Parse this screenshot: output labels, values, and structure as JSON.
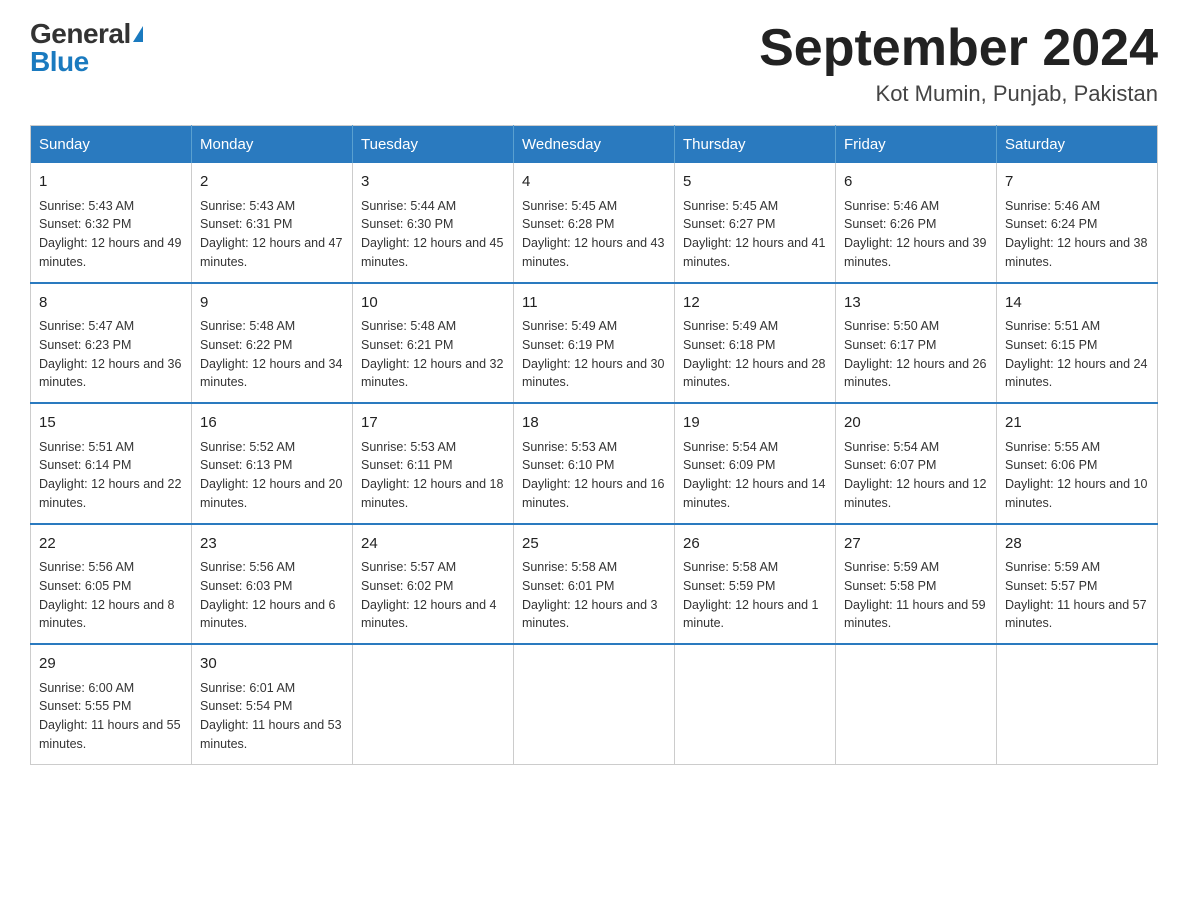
{
  "logo": {
    "general": "General",
    "blue": "Blue"
  },
  "title": "September 2024",
  "subtitle": "Kot Mumin, Punjab, Pakistan",
  "weekdays": [
    "Sunday",
    "Monday",
    "Tuesday",
    "Wednesday",
    "Thursday",
    "Friday",
    "Saturday"
  ],
  "weeks": [
    [
      {
        "day": "1",
        "sunrise": "5:43 AM",
        "sunset": "6:32 PM",
        "daylight": "12 hours and 49 minutes."
      },
      {
        "day": "2",
        "sunrise": "5:43 AM",
        "sunset": "6:31 PM",
        "daylight": "12 hours and 47 minutes."
      },
      {
        "day": "3",
        "sunrise": "5:44 AM",
        "sunset": "6:30 PM",
        "daylight": "12 hours and 45 minutes."
      },
      {
        "day": "4",
        "sunrise": "5:45 AM",
        "sunset": "6:28 PM",
        "daylight": "12 hours and 43 minutes."
      },
      {
        "day": "5",
        "sunrise": "5:45 AM",
        "sunset": "6:27 PM",
        "daylight": "12 hours and 41 minutes."
      },
      {
        "day": "6",
        "sunrise": "5:46 AM",
        "sunset": "6:26 PM",
        "daylight": "12 hours and 39 minutes."
      },
      {
        "day": "7",
        "sunrise": "5:46 AM",
        "sunset": "6:24 PM",
        "daylight": "12 hours and 38 minutes."
      }
    ],
    [
      {
        "day": "8",
        "sunrise": "5:47 AM",
        "sunset": "6:23 PM",
        "daylight": "12 hours and 36 minutes."
      },
      {
        "day": "9",
        "sunrise": "5:48 AM",
        "sunset": "6:22 PM",
        "daylight": "12 hours and 34 minutes."
      },
      {
        "day": "10",
        "sunrise": "5:48 AM",
        "sunset": "6:21 PM",
        "daylight": "12 hours and 32 minutes."
      },
      {
        "day": "11",
        "sunrise": "5:49 AM",
        "sunset": "6:19 PM",
        "daylight": "12 hours and 30 minutes."
      },
      {
        "day": "12",
        "sunrise": "5:49 AM",
        "sunset": "6:18 PM",
        "daylight": "12 hours and 28 minutes."
      },
      {
        "day": "13",
        "sunrise": "5:50 AM",
        "sunset": "6:17 PM",
        "daylight": "12 hours and 26 minutes."
      },
      {
        "day": "14",
        "sunrise": "5:51 AM",
        "sunset": "6:15 PM",
        "daylight": "12 hours and 24 minutes."
      }
    ],
    [
      {
        "day": "15",
        "sunrise": "5:51 AM",
        "sunset": "6:14 PM",
        "daylight": "12 hours and 22 minutes."
      },
      {
        "day": "16",
        "sunrise": "5:52 AM",
        "sunset": "6:13 PM",
        "daylight": "12 hours and 20 minutes."
      },
      {
        "day": "17",
        "sunrise": "5:53 AM",
        "sunset": "6:11 PM",
        "daylight": "12 hours and 18 minutes."
      },
      {
        "day": "18",
        "sunrise": "5:53 AM",
        "sunset": "6:10 PM",
        "daylight": "12 hours and 16 minutes."
      },
      {
        "day": "19",
        "sunrise": "5:54 AM",
        "sunset": "6:09 PM",
        "daylight": "12 hours and 14 minutes."
      },
      {
        "day": "20",
        "sunrise": "5:54 AM",
        "sunset": "6:07 PM",
        "daylight": "12 hours and 12 minutes."
      },
      {
        "day": "21",
        "sunrise": "5:55 AM",
        "sunset": "6:06 PM",
        "daylight": "12 hours and 10 minutes."
      }
    ],
    [
      {
        "day": "22",
        "sunrise": "5:56 AM",
        "sunset": "6:05 PM",
        "daylight": "12 hours and 8 minutes."
      },
      {
        "day": "23",
        "sunrise": "5:56 AM",
        "sunset": "6:03 PM",
        "daylight": "12 hours and 6 minutes."
      },
      {
        "day": "24",
        "sunrise": "5:57 AM",
        "sunset": "6:02 PM",
        "daylight": "12 hours and 4 minutes."
      },
      {
        "day": "25",
        "sunrise": "5:58 AM",
        "sunset": "6:01 PM",
        "daylight": "12 hours and 3 minutes."
      },
      {
        "day": "26",
        "sunrise": "5:58 AM",
        "sunset": "5:59 PM",
        "daylight": "12 hours and 1 minute."
      },
      {
        "day": "27",
        "sunrise": "5:59 AM",
        "sunset": "5:58 PM",
        "daylight": "11 hours and 59 minutes."
      },
      {
        "day": "28",
        "sunrise": "5:59 AM",
        "sunset": "5:57 PM",
        "daylight": "11 hours and 57 minutes."
      }
    ],
    [
      {
        "day": "29",
        "sunrise": "6:00 AM",
        "sunset": "5:55 PM",
        "daylight": "11 hours and 55 minutes."
      },
      {
        "day": "30",
        "sunrise": "6:01 AM",
        "sunset": "5:54 PM",
        "daylight": "11 hours and 53 minutes."
      },
      null,
      null,
      null,
      null,
      null
    ]
  ]
}
